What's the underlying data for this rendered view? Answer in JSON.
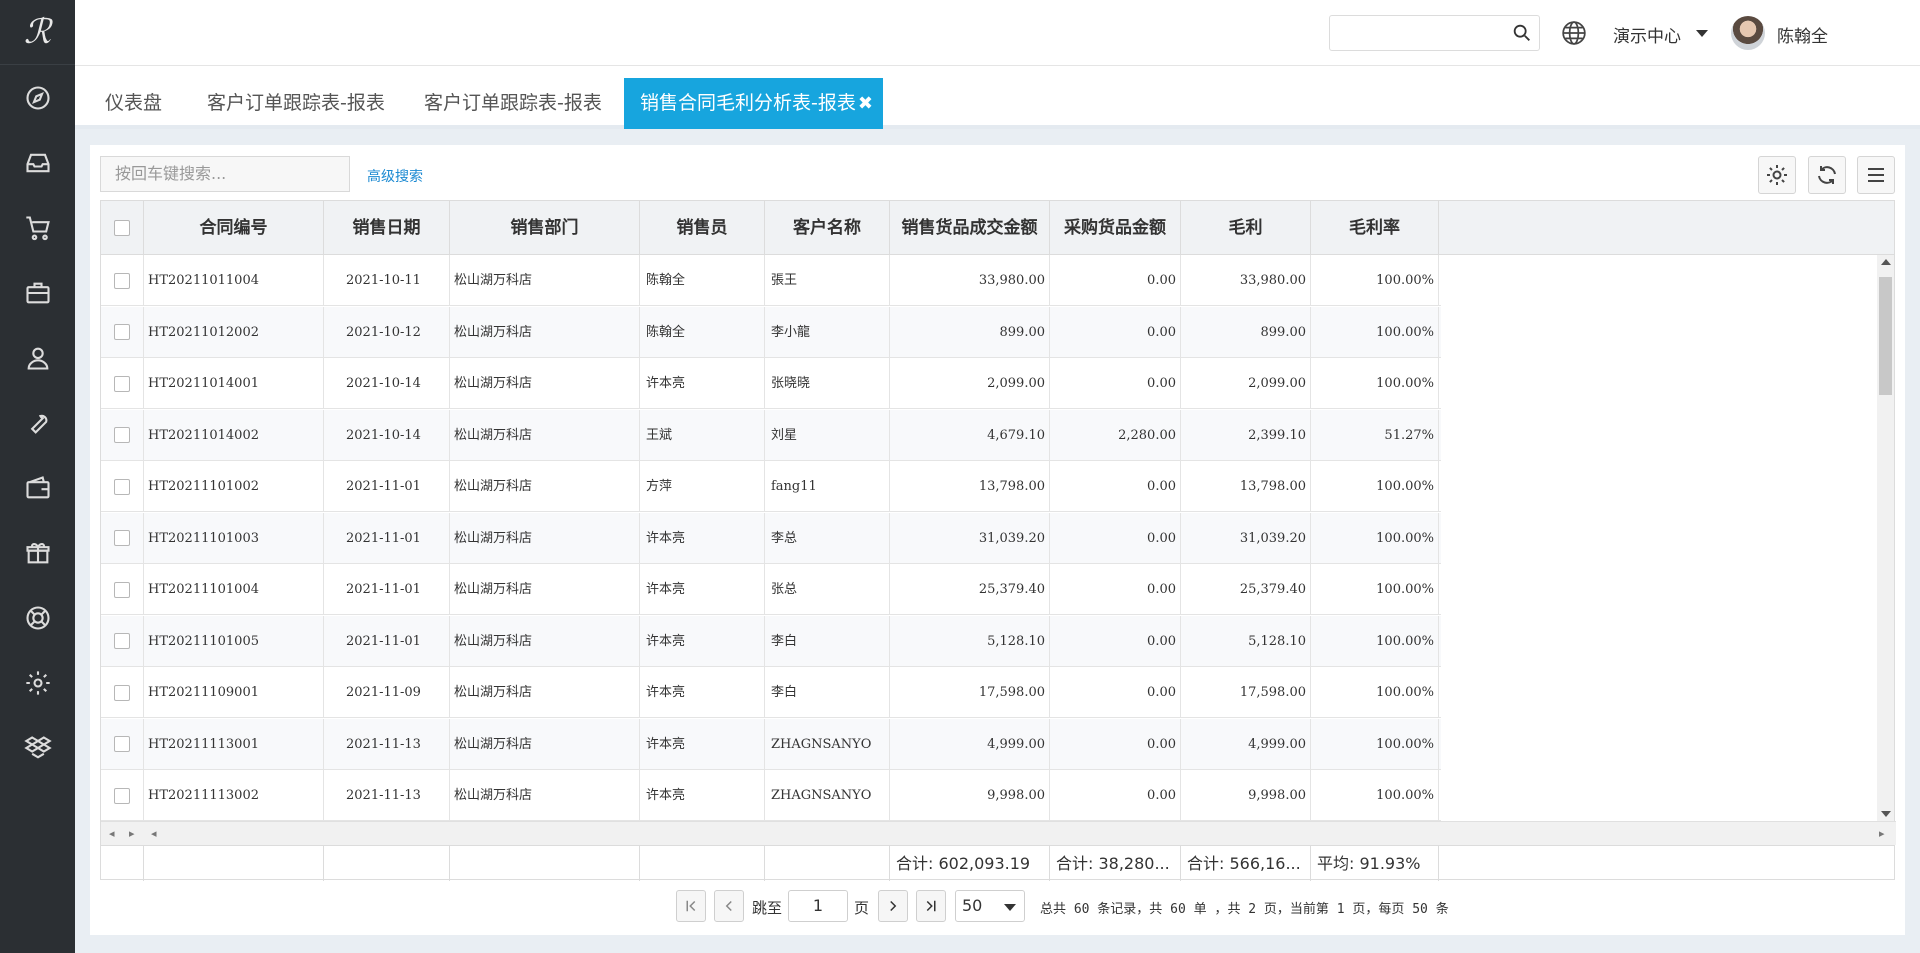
{
  "sidebar": {
    "logo": "ℛ",
    "icons": [
      "compass-icon",
      "inbox-icon",
      "cart-icon",
      "briefcase-icon",
      "user-icon",
      "wrench-icon",
      "wallet-icon",
      "gift-icon",
      "lifebuoy-icon",
      "gear-icon",
      "dropbox-icon"
    ]
  },
  "header": {
    "search_placeholder": "",
    "center_label": "演示中心",
    "username": "陈翰全",
    "help": "?"
  },
  "tabs": [
    {
      "label": "仪表盘"
    },
    {
      "label": "客户订单跟踪表-报表"
    },
    {
      "label": "客户订单跟踪表-报表"
    },
    {
      "label": "销售合同毛利分析表-报表",
      "close": "✖"
    }
  ],
  "toolbar": {
    "search_placeholder": "按回车键搜索...",
    "advanced": "高级搜索"
  },
  "table": {
    "columns": [
      "合同编号",
      "销售日期",
      "销售部门",
      "销售员",
      "客户名称",
      "销售货品成交金额",
      "采购货品金额",
      "毛利",
      "毛利率"
    ],
    "rows": [
      [
        "HT20211011004",
        "2021-10-11",
        "松山湖万科店",
        "陈翰全",
        "張王",
        "33,980.00",
        "0.00",
        "33,980.00",
        "100.00%"
      ],
      [
        "HT20211012002",
        "2021-10-12",
        "松山湖万科店",
        "陈翰全",
        "李小龍",
        "899.00",
        "0.00",
        "899.00",
        "100.00%"
      ],
      [
        "HT20211014001",
        "2021-10-14",
        "松山湖万科店",
        "许本亮",
        "张晓晓",
        "2,099.00",
        "0.00",
        "2,099.00",
        "100.00%"
      ],
      [
        "HT20211014002",
        "2021-10-14",
        "松山湖万科店",
        "王斌",
        "刘星",
        "4,679.10",
        "2,280.00",
        "2,399.10",
        "51.27%"
      ],
      [
        "HT20211101002",
        "2021-11-01",
        "松山湖万科店",
        "方萍",
        "fang11",
        "13,798.00",
        "0.00",
        "13,798.00",
        "100.00%"
      ],
      [
        "HT20211101003",
        "2021-11-01",
        "松山湖万科店",
        "许本亮",
        "李总",
        "31,039.20",
        "0.00",
        "31,039.20",
        "100.00%"
      ],
      [
        "HT20211101004",
        "2021-11-01",
        "松山湖万科店",
        "许本亮",
        "张总",
        "25,379.40",
        "0.00",
        "25,379.40",
        "100.00%"
      ],
      [
        "HT20211101005",
        "2021-11-01",
        "松山湖万科店",
        "许本亮",
        "李白",
        "5,128.10",
        "0.00",
        "5,128.10",
        "100.00%"
      ],
      [
        "HT20211109001",
        "2021-11-09",
        "松山湖万科店",
        "许本亮",
        "李白",
        "17,598.00",
        "0.00",
        "17,598.00",
        "100.00%"
      ],
      [
        "HT20211113001",
        "2021-11-13",
        "松山湖万科店",
        "许本亮",
        "ZHAGNSANYO",
        "4,999.00",
        "0.00",
        "4,999.00",
        "100.00%"
      ],
      [
        "HT20211113002",
        "2021-11-13",
        "松山湖万科店",
        "许本亮",
        "ZHAGNSANYO",
        "9,998.00",
        "0.00",
        "9,998.00",
        "100.00%"
      ]
    ],
    "footer": {
      "sales_total": "合计: 602,093.19",
      "purchase_total": "合计: 38,280...",
      "profit_total": "合计: 566,16...",
      "rate_avg": "平均: 91.93%"
    }
  },
  "pagination": {
    "goto_label": "跳至",
    "page_value": "1",
    "page_unit": "页",
    "page_size": "50",
    "info": "总共 60 条记录，共 60 单 ，共 2 页，当前第 1 页，每页 50 条"
  }
}
